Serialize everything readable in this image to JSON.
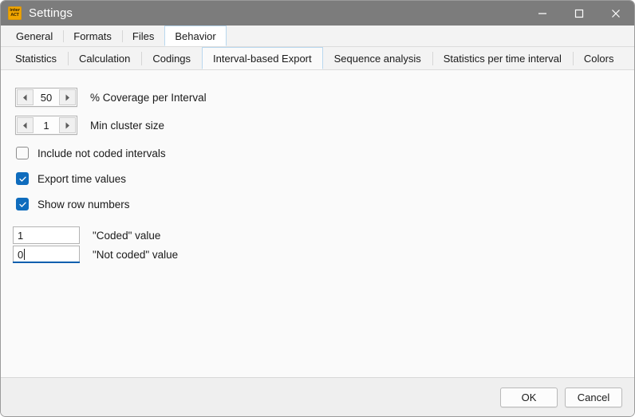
{
  "window": {
    "title": "Settings",
    "icon_line1": "inter",
    "icon_line2": "ACT",
    "controls": {
      "minimize": "minimize-icon",
      "maximize": "maximize-icon",
      "close": "close-icon"
    }
  },
  "tabs_primary": [
    {
      "label": "General",
      "selected": false
    },
    {
      "label": "Formats",
      "selected": false
    },
    {
      "label": "Files",
      "selected": false
    },
    {
      "label": "Behavior",
      "selected": true
    }
  ],
  "tabs_secondary": [
    {
      "label": "Statistics",
      "selected": false
    },
    {
      "label": "Calculation",
      "selected": false
    },
    {
      "label": "Codings",
      "selected": false
    },
    {
      "label": "Interval-based Export",
      "selected": true
    },
    {
      "label": "Sequence analysis",
      "selected": false
    },
    {
      "label": "Statistics per time interval",
      "selected": false
    },
    {
      "label": "Colors",
      "selected": false
    }
  ],
  "panel": {
    "spinners": [
      {
        "value": "50",
        "label": "% Coverage per Interval",
        "dec_icon": "triangle-left-icon",
        "inc_icon": "triangle-right-icon"
      },
      {
        "value": "1",
        "label": "Min cluster size",
        "dec_icon": "triangle-left-icon",
        "inc_icon": "triangle-right-icon"
      }
    ],
    "checkboxes": [
      {
        "label": "Include not coded intervals",
        "checked": false
      },
      {
        "label": "Export time values",
        "checked": true
      },
      {
        "label": "Show row numbers",
        "checked": true
      }
    ],
    "textfields": [
      {
        "value": "1",
        "label": "\"Coded\" value",
        "focused": false
      },
      {
        "value": "0",
        "label": "\"Not coded\" value",
        "focused": true
      }
    ]
  },
  "footer": {
    "ok_label": "OK",
    "cancel_label": "Cancel"
  },
  "colors": {
    "titlebar": "#7c7c7c",
    "accent_checkbox": "#0f6cbd",
    "focus_underline": "#0b5fae",
    "tab_selected_border": "#b9d8ef",
    "app_icon": "#f0a500"
  }
}
